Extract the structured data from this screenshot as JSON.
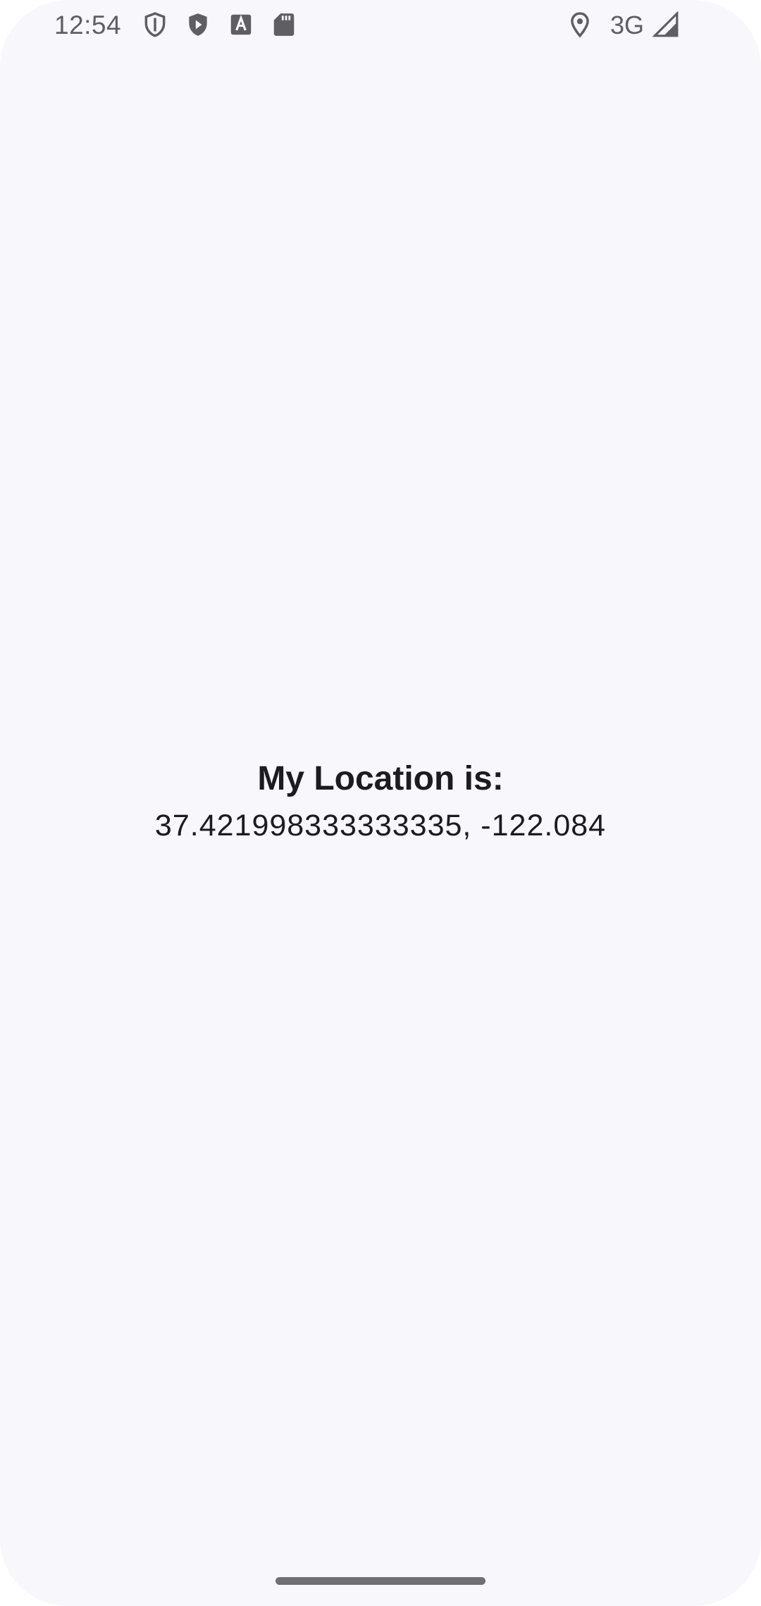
{
  "status_bar": {
    "time": "12:54",
    "icons_left": [
      "shield-outline-icon",
      "play-shield-icon",
      "text-a-icon",
      "sd-card-icon"
    ],
    "icons_right": [
      "location-pin-icon",
      "signal-icon"
    ],
    "network": "3G"
  },
  "main": {
    "title": "My Location is:",
    "coordinates": "37.421998333333335, -122.084"
  },
  "colors": {
    "background": "#f8f7fc",
    "text": "#1c1b1f",
    "status_icons": "#5f5f63"
  }
}
